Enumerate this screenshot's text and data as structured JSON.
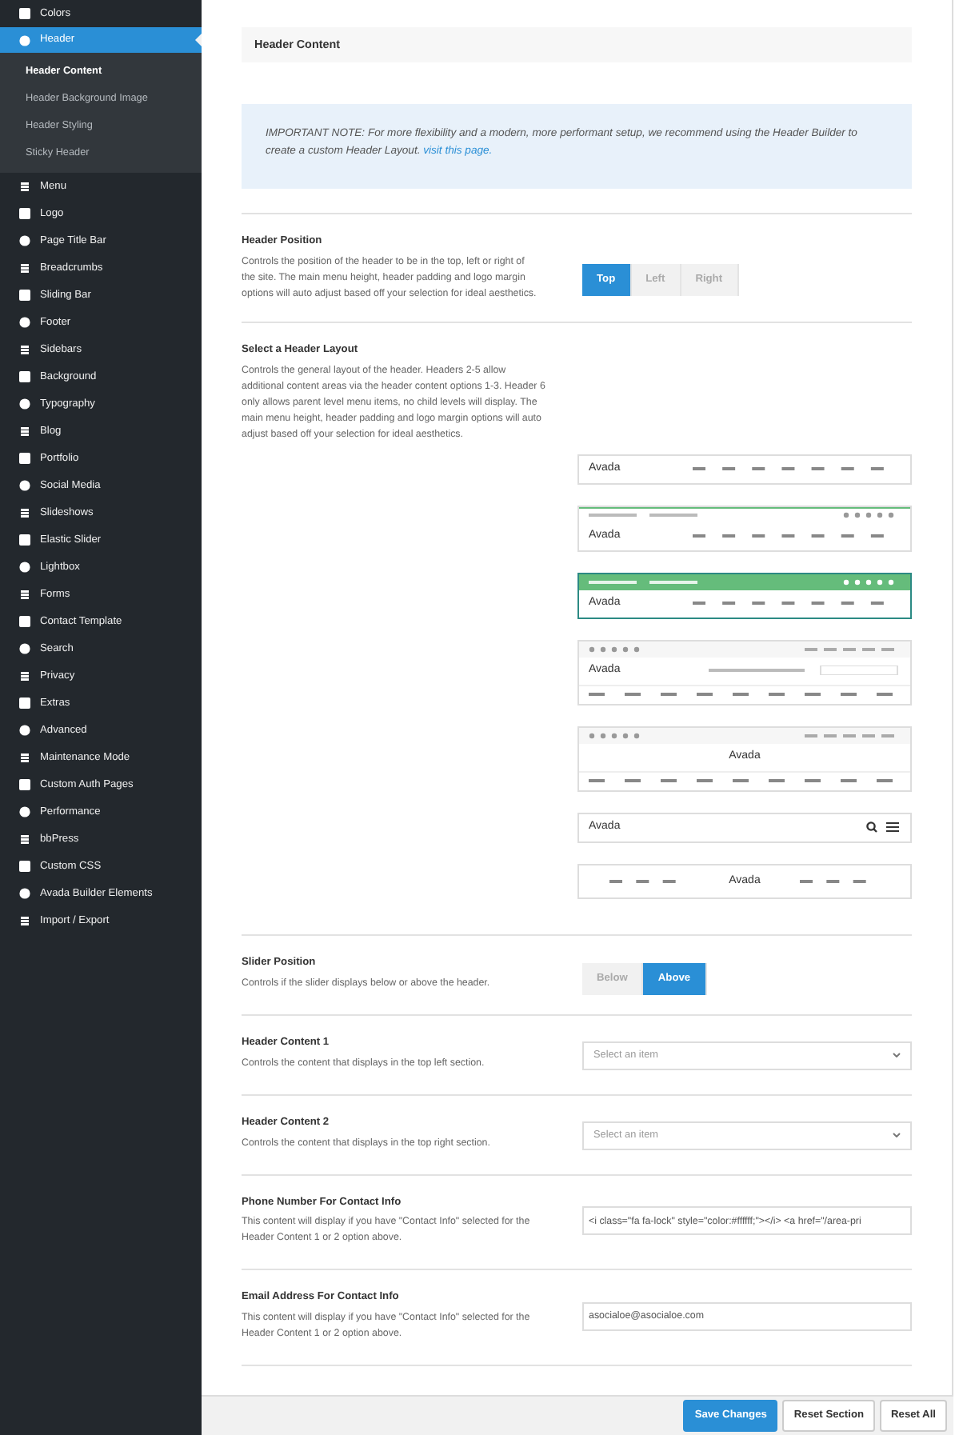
{
  "sidebar": {
    "items": [
      {
        "label": "Colors",
        "selected": false
      },
      {
        "label": "Header",
        "selected": true,
        "children": [
          {
            "label": "Header Content",
            "selected": true
          },
          {
            "label": "Header Background Image",
            "selected": false
          },
          {
            "label": "Header Styling",
            "selected": false
          },
          {
            "label": "Sticky Header",
            "selected": false
          }
        ]
      },
      {
        "label": "Menu",
        "selected": false
      },
      {
        "label": "Logo",
        "selected": false
      },
      {
        "label": "Page Title Bar",
        "selected": false
      },
      {
        "label": "Breadcrumbs",
        "selected": false
      },
      {
        "label": "Sliding Bar",
        "selected": false
      },
      {
        "label": "Footer",
        "selected": false
      },
      {
        "label": "Sidebars",
        "selected": false
      },
      {
        "label": "Background",
        "selected": false
      },
      {
        "label": "Typography",
        "selected": false
      },
      {
        "label": "Blog",
        "selected": false
      },
      {
        "label": "Portfolio",
        "selected": false
      },
      {
        "label": "Social Media",
        "selected": false
      },
      {
        "label": "Slideshows",
        "selected": false
      },
      {
        "label": "Elastic Slider",
        "selected": false
      },
      {
        "label": "Lightbox",
        "selected": false
      },
      {
        "label": "Forms",
        "selected": false
      },
      {
        "label": "Contact Template",
        "selected": false
      },
      {
        "label": "Search",
        "selected": false
      },
      {
        "label": "Privacy",
        "selected": false
      },
      {
        "label": "Extras",
        "selected": false
      },
      {
        "label": "Advanced",
        "selected": false
      },
      {
        "label": "Maintenance Mode",
        "selected": false
      },
      {
        "label": "Custom Auth Pages",
        "selected": false
      },
      {
        "label": "Performance",
        "selected": false
      },
      {
        "label": "bbPress",
        "selected": false
      },
      {
        "label": "Custom CSS",
        "selected": false
      },
      {
        "label": "Avada Builder Elements",
        "selected": false
      },
      {
        "label": "Import / Export",
        "selected": false
      }
    ]
  },
  "section_title": "Header Content",
  "notice": {
    "text": "*IMPORTANT NOTE:* For more flexibility and a modern, more performant setup, we recommend using the Header Builder to create a custom Header Layout.",
    "link": "visit this page."
  },
  "options": [
    {
      "kind": "buttons",
      "title": "Header Position",
      "description": "Controls the position of the header to be in the top, left or right of the site. The main menu height, header padding and logo margin options will auto adjust based off your selection for ideal aesthetics.",
      "choices": [
        {
          "label": "Top",
          "selected": true
        },
        {
          "label": "Left",
          "selected": false
        },
        {
          "label": "Right",
          "selected": false
        }
      ]
    },
    {
      "kind": "layouts",
      "title": "Select a Header Layout",
      "description": "Controls the general layout of the header. Headers 2-5 allow additional content areas via the header content options 1-3. Header 6 only allows parent level menu items, no child levels will display. The main menu height, header padding and logo margin options will auto adjust based off your selection for ideal aesthetics.",
      "layouts": [
        {
          "kind": "plain",
          "logo": "Avada",
          "selected": false
        },
        {
          "kind": "topbar",
          "logo": "Avada",
          "selected": false
        },
        {
          "kind": "topbar",
          "logo": "Avada",
          "selected": true
        },
        {
          "kind": "stacked",
          "logo": "Avada",
          "selected": false
        },
        {
          "kind": "centered",
          "logo": "Avada",
          "selected": false
        },
        {
          "kind": "icons",
          "logo": "Avada",
          "selected": false
        },
        {
          "kind": "split",
          "logo": "Avada",
          "selected": false
        }
      ]
    },
    {
      "kind": "buttons",
      "title": "Slider Position",
      "description": "Controls if the slider displays below or above the header.",
      "choices": [
        {
          "label": "Below",
          "selected": false
        },
        {
          "label": "Above",
          "selected": true
        }
      ]
    },
    {
      "kind": "select",
      "title": "Header Content 1",
      "description": "Controls the content that displays in the top left section.",
      "placeholder": "Select an item"
    },
    {
      "kind": "select",
      "title": "Header Content 2",
      "description": "Controls the content that displays in the top right section.",
      "placeholder": "Select an item"
    },
    {
      "kind": "text",
      "title": "Phone Number For Contact Info",
      "description": "This content will display if you have \"Contact Info\" selected for the Header Content 1 or 2 option above.",
      "value": "<i class=\"fa fa-lock\" style=\"color:#ffffff;\"></i> <a href=\"/area-pri"
    },
    {
      "kind": "text",
      "title": "Email Address For Contact Info",
      "description": "This content will display if you have \"Contact Info\" selected for the Header Content 1 or 2 option above.",
      "value": "asocialoe@asocialoe.com"
    }
  ],
  "footer_buttons": [
    {
      "label": "Save Changes",
      "kind": "primary"
    },
    {
      "label": "Reset Section",
      "kind": "secondary"
    },
    {
      "label": "Reset All",
      "kind": "secondary"
    }
  ]
}
